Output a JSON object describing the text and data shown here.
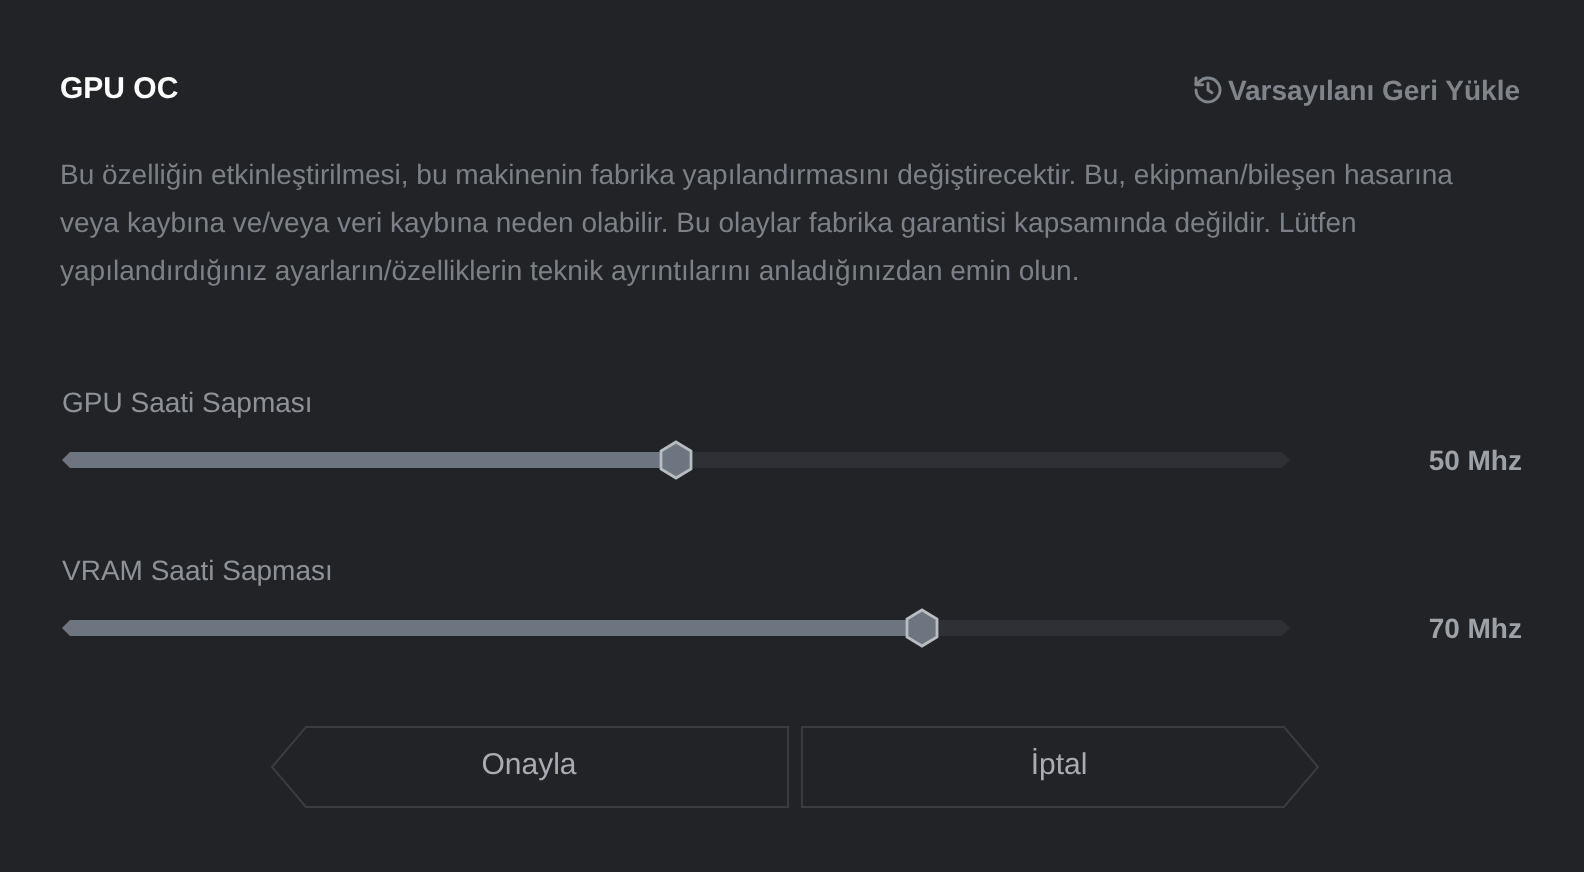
{
  "title": "GPU OC",
  "reset_link": "Varsayılanı Geri Yükle",
  "description": "Bu özelliğin etkinleştirilmesi, bu makinenin fabrika yapılandırmasını değiştirecektir. Bu, ekipman/bileşen hasarına veya kaybına ve/veya veri kaybına neden olabilir. Bu olaylar fabrika garantisi kapsamında değildir. Lütfen yapılandırdığınız ayarların/özelliklerin teknik ayrıntılarını anladığınızdan emin olun.",
  "sliders": [
    {
      "label": "GPU Saati Sapması",
      "level": 0.5,
      "reading": "50 Mhz"
    },
    {
      "label": "VRAM Saati Sapması",
      "level": 0.7,
      "reading": "70 Mhz"
    }
  ],
  "buttons": [
    {
      "label": "Onayla",
      "kind": "left"
    },
    {
      "label": "İptal",
      "kind": "right"
    }
  ]
}
